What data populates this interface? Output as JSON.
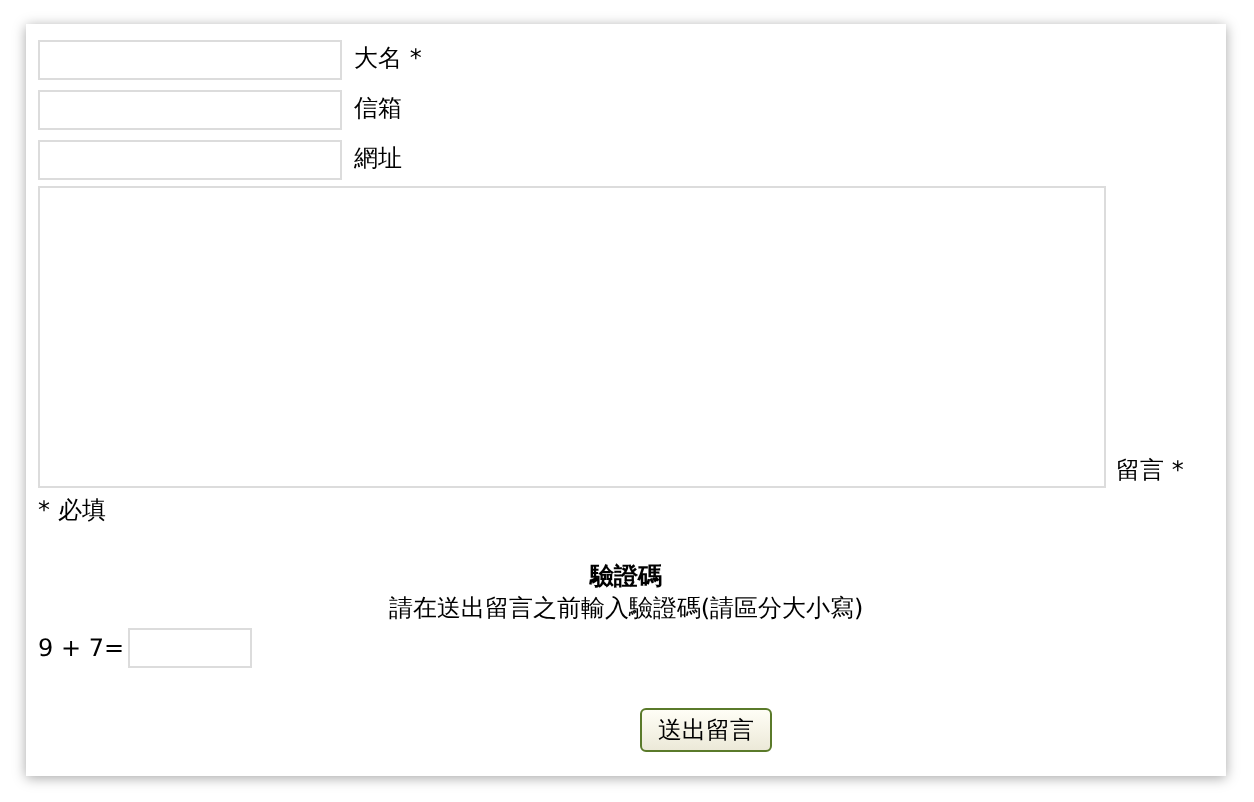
{
  "fields": [
    {
      "label": "大名 *"
    },
    {
      "label": "信箱"
    },
    {
      "label": "網址"
    }
  ],
  "message": {
    "label": "留言 *"
  },
  "required_note": "* 必填",
  "captcha": {
    "title": "驗證碼",
    "hint": "請在送出留言之前輸入驗證碼(請區分大小寫)",
    "question": "9 + 7="
  },
  "submit": "送出留言"
}
